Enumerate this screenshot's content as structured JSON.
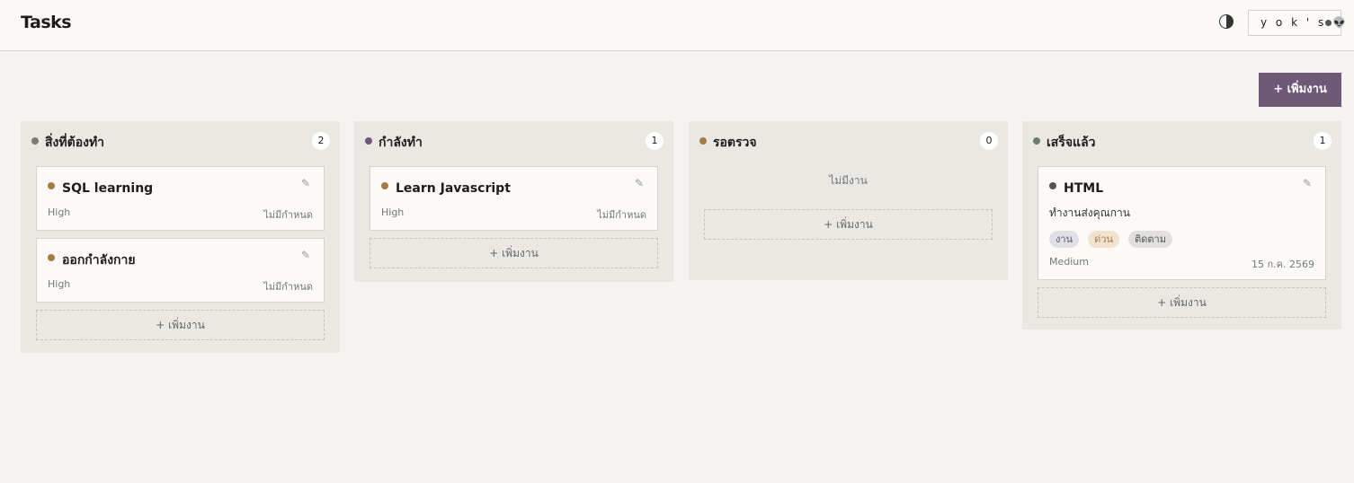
{
  "header": {
    "title": "Tasks",
    "user": "y o k ' s 👽"
  },
  "actions": {
    "add_task": "+ เพิ่มงาน",
    "add_in_column": "+ เพิ่มงาน"
  },
  "columns": [
    {
      "title": "สิ่งที่ต้องทำ",
      "count": "2",
      "dot_color": "#7d7a74",
      "cards": [
        {
          "title": "SQL learning",
          "priority": "High",
          "due": "ไม่มีกำหนด",
          "dot_color": "#a47a45"
        },
        {
          "title": "ออกกำลังกาย",
          "priority": "High",
          "due": "ไม่มีกำหนด",
          "dot_color": "#a47a45"
        }
      ]
    },
    {
      "title": "กำลังทำ",
      "count": "1",
      "dot_color": "#6e5a78",
      "cards": [
        {
          "title": "Learn Javascript",
          "priority": "High",
          "due": "ไม่มีกำหนด",
          "dot_color": "#a47a45"
        }
      ]
    },
    {
      "title": "รอตรวจ",
      "count": "0",
      "dot_color": "#a47a45",
      "empty_text": "ไม่มีงาน",
      "cards": []
    },
    {
      "title": "เสร็จแล้ว",
      "count": "1",
      "dot_color": "#6d7e6a",
      "cards": [
        {
          "title": "HTML",
          "description": "ทำงานส่งคุณกาน",
          "tags": [
            {
              "label": "งาน",
              "bg": "#e1dfe6",
              "color": "#5b5576"
            },
            {
              "label": "ด่วน",
              "bg": "#f2e3d1",
              "color": "#a47a45"
            },
            {
              "label": "ติดตาม",
              "bg": "#e1e0dc",
              "color": "#555"
            }
          ],
          "priority": "Medium",
          "due": "15 ก.ค. 2569",
          "dot_color": "#555"
        }
      ]
    }
  ]
}
